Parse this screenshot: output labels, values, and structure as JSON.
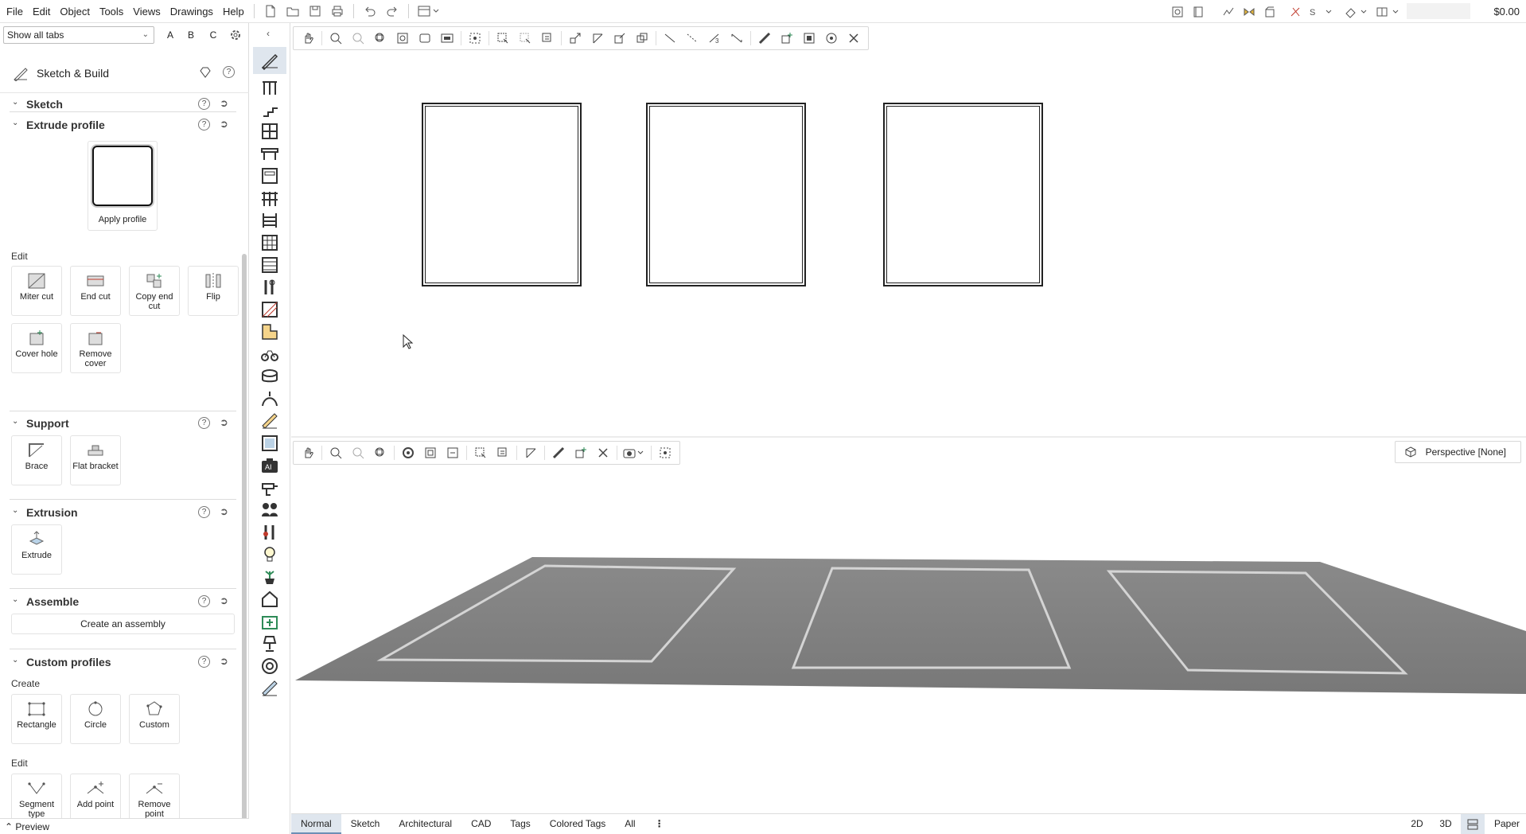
{
  "menu": [
    "File",
    "Edit",
    "Object",
    "Tools",
    "Views",
    "Drawings",
    "Help"
  ],
  "price": "$0.00",
  "tab_filter": {
    "value": "Show all tabs",
    "letters": [
      "A",
      "B",
      "C"
    ]
  },
  "panel": {
    "title": "Sketch & Build"
  },
  "sections": {
    "sketch": "Sketch",
    "extrude_profile": "Extrude profile",
    "apply_profile": "Apply profile",
    "edit_label": "Edit",
    "edit_tools": [
      "Miter cut",
      "End cut",
      "Copy end cut",
      "Flip",
      "Cover hole",
      "Remove cover"
    ],
    "support": "Support",
    "support_tools": [
      "Brace",
      "Flat bracket"
    ],
    "extrusion": "Extrusion",
    "extrusion_tools": [
      "Extrude"
    ],
    "assemble": "Assemble",
    "create_assembly": "Create an assembly",
    "custom_profiles": "Custom profiles",
    "create_label": "Create",
    "create_tools": [
      "Rectangle",
      "Circle",
      "Custom"
    ],
    "edit2_label": "Edit",
    "edit2_tools": [
      "Segment type",
      "Add point",
      "Remove point"
    ]
  },
  "preview": "Preview",
  "perspective": "Perspective [None]",
  "bottom_tabs": [
    "Normal",
    "Sketch",
    "Architectural",
    "CAD",
    "Tags",
    "Colored Tags",
    "All"
  ],
  "view_modes": [
    "2D",
    "3D",
    "Paper"
  ],
  "colors": {
    "active_tab": "#dfe6ee",
    "floor": "#7d7d7d",
    "outline": "#222222"
  }
}
